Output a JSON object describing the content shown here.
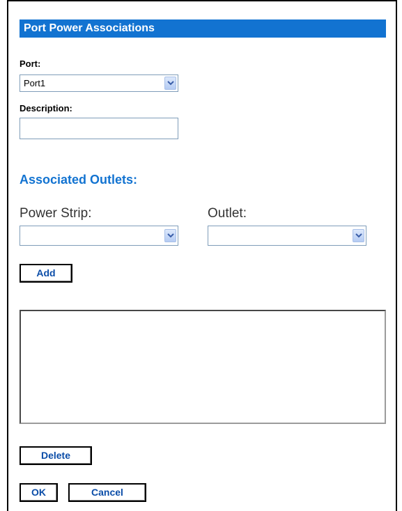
{
  "dialog": {
    "title": "Port Power Associations",
    "port_label": "Port:",
    "port_value": "Port1",
    "description_label": "Description:",
    "description_value": "",
    "section_title": "Associated Outlets:",
    "power_strip_label": "Power Strip:",
    "power_strip_value": "",
    "outlet_label": "Outlet:",
    "outlet_value": "",
    "add_label": "Add",
    "delete_label": "Delete",
    "ok_label": "OK",
    "cancel_label": "Cancel",
    "associations_list": []
  },
  "colors": {
    "accent": "#1273d1",
    "button_text": "#0b4da8"
  }
}
